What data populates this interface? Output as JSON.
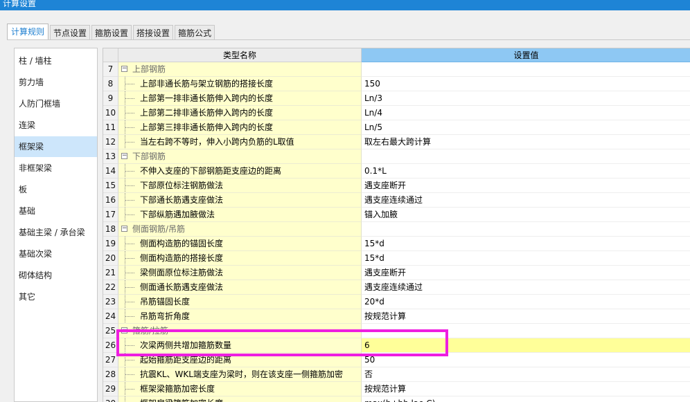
{
  "window": {
    "title": "计算设置"
  },
  "tabs": [
    {
      "label": "计算规则",
      "active": true
    },
    {
      "label": "节点设置"
    },
    {
      "label": "箍筋设置"
    },
    {
      "label": "搭接设置"
    },
    {
      "label": "箍筋公式"
    }
  ],
  "sidebar": {
    "items": [
      {
        "label": "柱 / 墙柱"
      },
      {
        "label": "剪力墙"
      },
      {
        "label": "人防门框墙"
      },
      {
        "label": "连梁"
      },
      {
        "label": "框架梁",
        "active": true
      },
      {
        "label": "非框架梁"
      },
      {
        "label": "板"
      },
      {
        "label": "基础"
      },
      {
        "label": "基础主梁 / 承台梁"
      },
      {
        "label": "基础次梁"
      },
      {
        "label": "砌体结构"
      },
      {
        "label": "其它"
      }
    ]
  },
  "grid": {
    "header": {
      "name": "类型名称",
      "value": "设置值"
    },
    "rows": [
      {
        "num": "7",
        "name": "上部钢筋",
        "value": "",
        "group": true
      },
      {
        "num": "8",
        "name": "上部非通长筋与架立钢筋的搭接长度",
        "value": "150"
      },
      {
        "num": "9",
        "name": "上部第一排非通长筋伸入跨内的长度",
        "value": "Ln/3"
      },
      {
        "num": "10",
        "name": "上部第二排非通长筋伸入跨内的长度",
        "value": "Ln/4"
      },
      {
        "num": "11",
        "name": "上部第三排非通长筋伸入跨内的长度",
        "value": "Ln/5"
      },
      {
        "num": "12",
        "name": "当左右跨不等时，伸入小跨内负筋的L取值",
        "value": "取左右最大跨计算"
      },
      {
        "num": "13",
        "name": "下部钢筋",
        "value": "",
        "group": true
      },
      {
        "num": "14",
        "name": "不伸入支座的下部钢筋距支座边的距离",
        "value": "0.1*L"
      },
      {
        "num": "15",
        "name": "下部原位标注钢筋做法",
        "value": "遇支座断开"
      },
      {
        "num": "16",
        "name": "下部通长筋遇支座做法",
        "value": "遇支座连续通过"
      },
      {
        "num": "17",
        "name": "下部纵筋遇加腋做法",
        "value": "锚入加腋"
      },
      {
        "num": "18",
        "name": "侧面钢筋/吊筋",
        "value": "",
        "group": true
      },
      {
        "num": "19",
        "name": "侧面构造筋的锚固长度",
        "value": "15*d"
      },
      {
        "num": "20",
        "name": "侧面构造筋的搭接长度",
        "value": "15*d"
      },
      {
        "num": "21",
        "name": "梁侧面原位标注筋做法",
        "value": "遇支座断开"
      },
      {
        "num": "22",
        "name": "侧面通长筋遇支座做法",
        "value": "遇支座连续通过"
      },
      {
        "num": "23",
        "name": "吊筋锚固长度",
        "value": "20*d"
      },
      {
        "num": "24",
        "name": "吊筋弯折角度",
        "value": "按规范计算"
      },
      {
        "num": "25",
        "name": "箍筋/拉筋",
        "value": "",
        "group": true
      },
      {
        "num": "26",
        "name": "次梁两侧共增加箍筋数量",
        "value": "6",
        "selected": true
      },
      {
        "num": "27",
        "name": "起始箍筋距支座边的距离",
        "value": "50"
      },
      {
        "num": "28",
        "name": "抗震KL、WKL端支座为梁时，则在该支座一侧箍筋加密",
        "value": "否"
      },
      {
        "num": "29",
        "name": "框架梁箍筋加密长度",
        "value": "按规范计算"
      },
      {
        "num": "30",
        "name": "框架扁梁箍筋加密长度",
        "value": "max(b+hb,lae,C)"
      }
    ]
  }
}
